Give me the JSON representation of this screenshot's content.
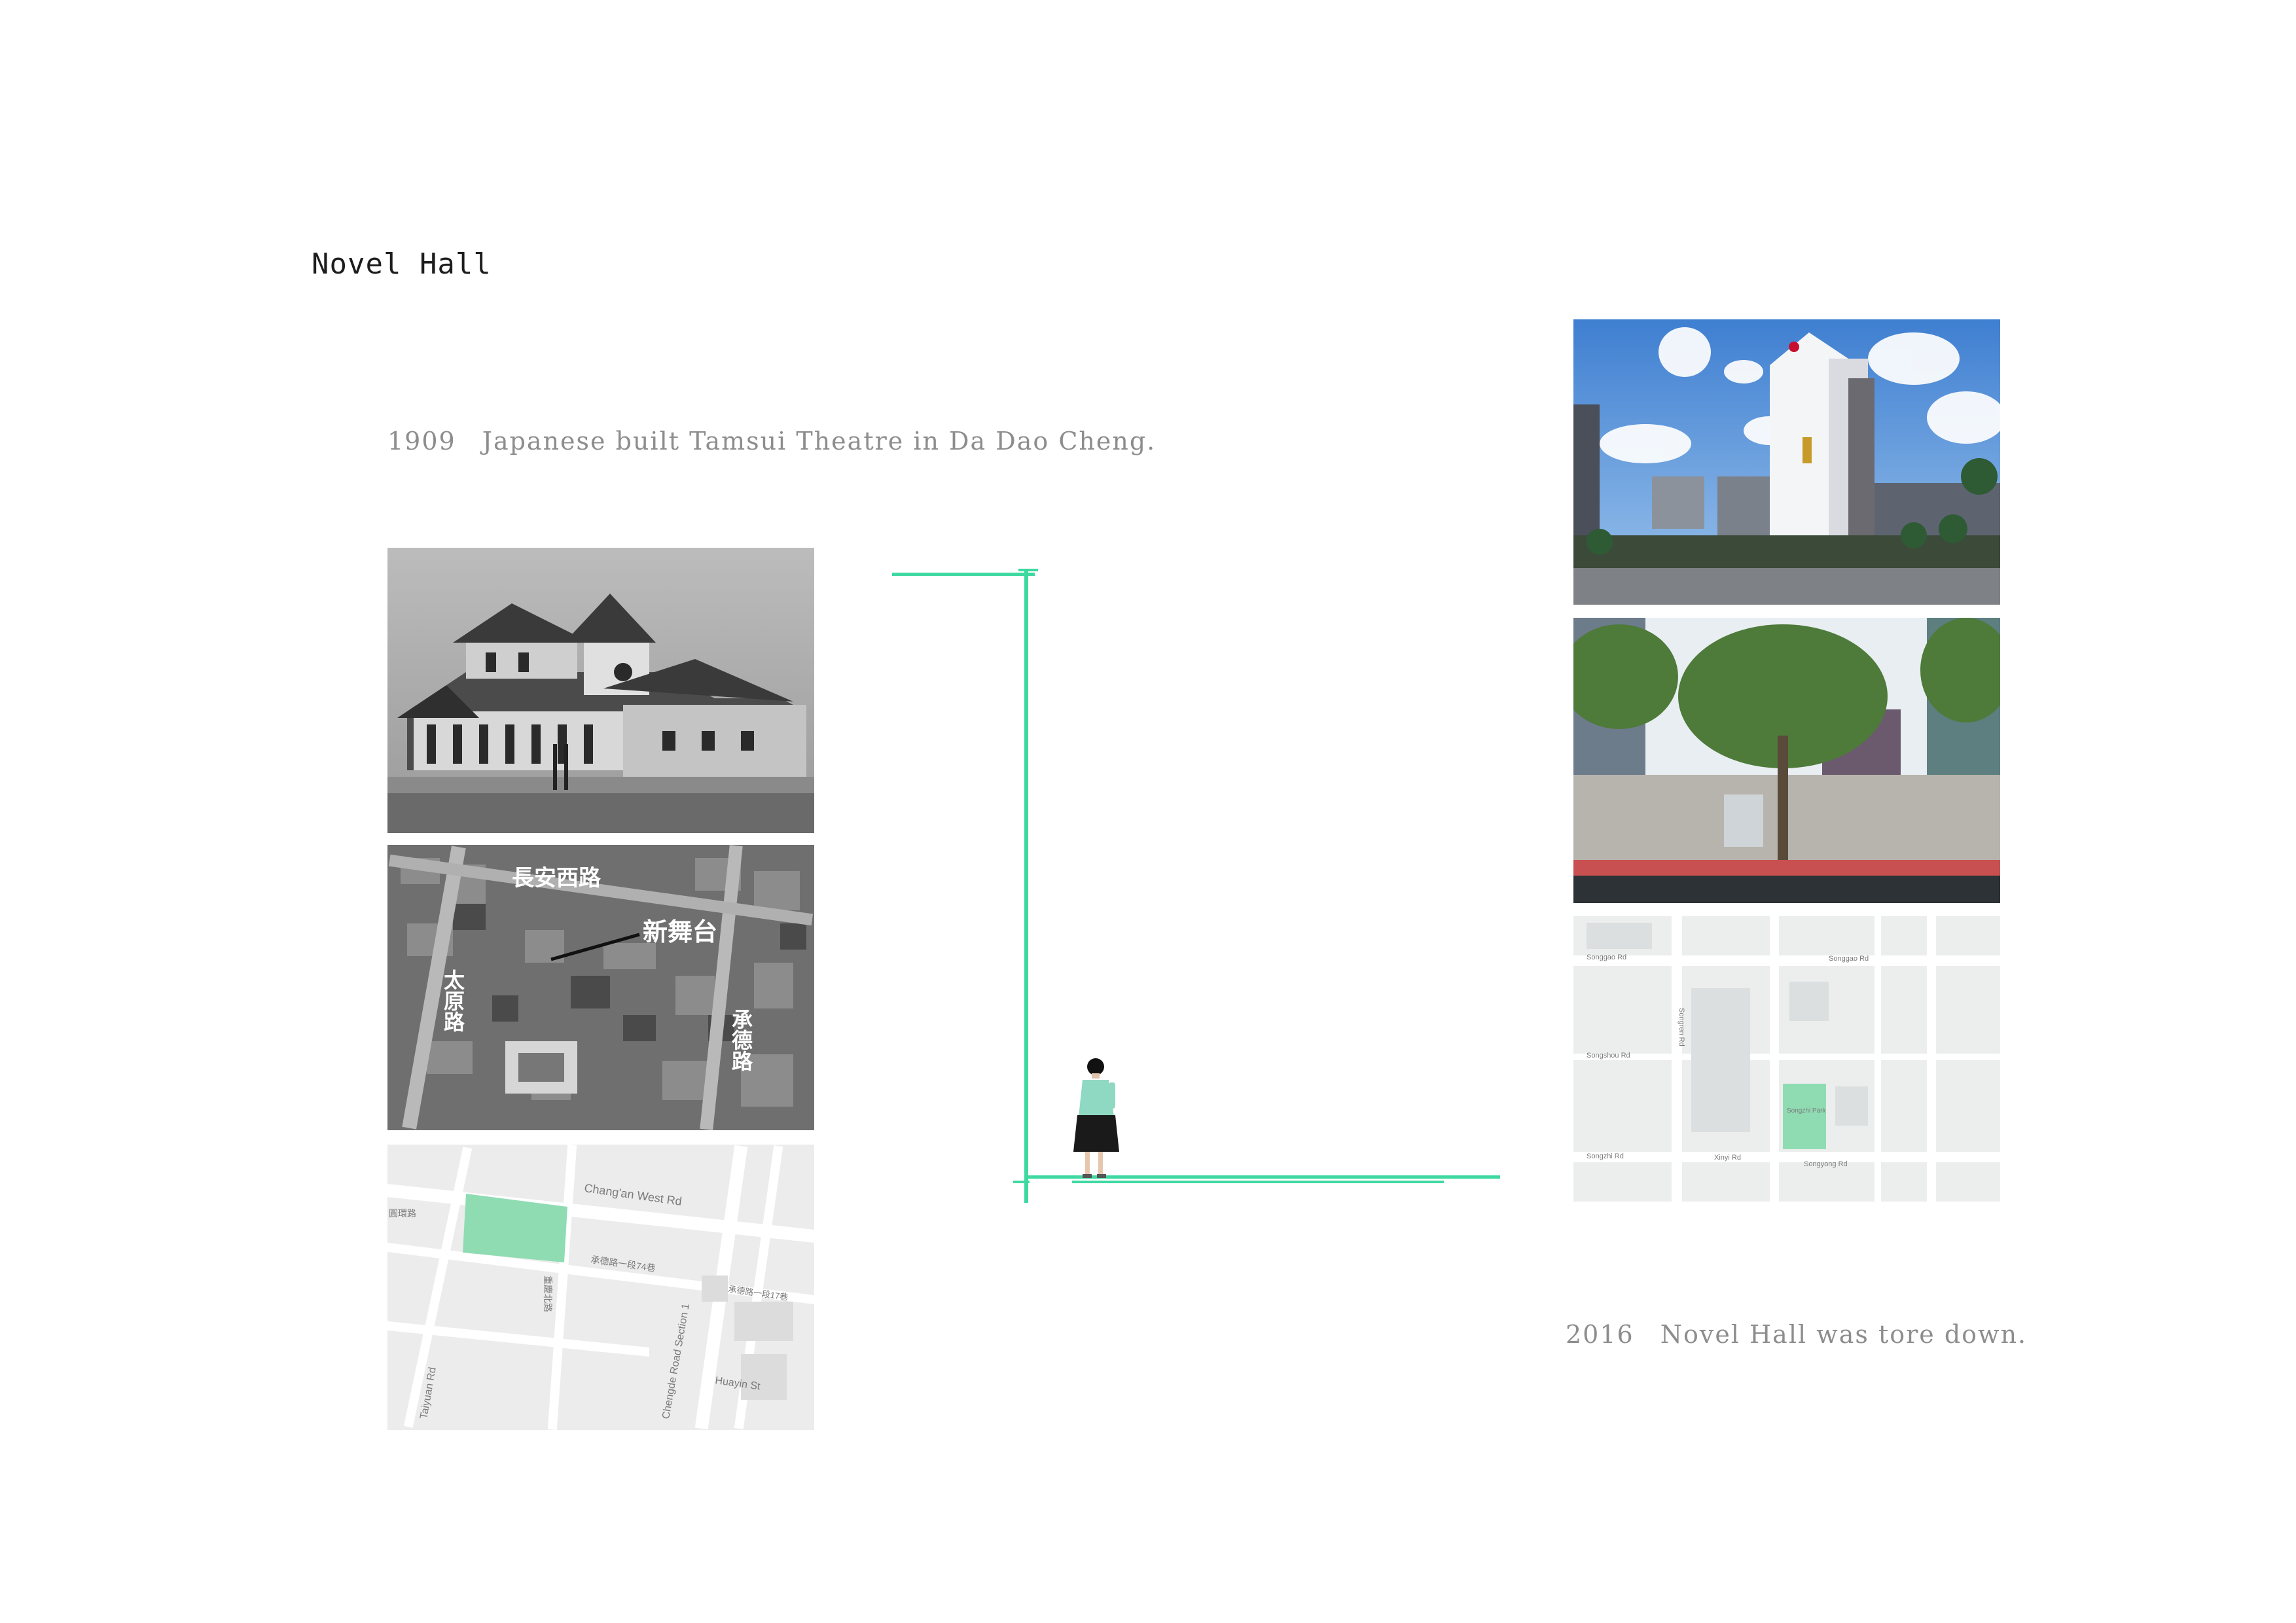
{
  "title": "Novel Hall",
  "timeline": {
    "start": {
      "year": "1909",
      "text": "Japanese built Tamsui Theatre in Da Dao Cheng."
    },
    "end": {
      "year": "2016",
      "text": "Novel Hall was tore down."
    }
  },
  "accent_color": "#3ed9a0",
  "aerial_labels": {
    "road_top": "長安西路",
    "landmark": "新舞台",
    "road_left": "太原路",
    "road_right": "承德路"
  },
  "old_map_labels": {
    "changan": "Chang'an West Rd",
    "left_road": "承德路",
    "lane": "承德路一段74巷",
    "section": "Chengde Road Section 1",
    "alley": "承德路一段17巷",
    "huayin": "Huayin St",
    "taiyuan": "Taiyuan Rd",
    "side_a": "圓環路",
    "side_b": "重慶北路"
  },
  "new_map_labels": {
    "songgao_w": "Songgao Rd",
    "songgao_e": "Songgao Rd",
    "songren": "Songren Rd",
    "songzhi": "Songzhi Rd",
    "songshou": "Songshou Rd",
    "songyong": "Songyong Rd",
    "xinyi": "Xinyi Rd",
    "songzhi_park": "Songzhi Park"
  }
}
